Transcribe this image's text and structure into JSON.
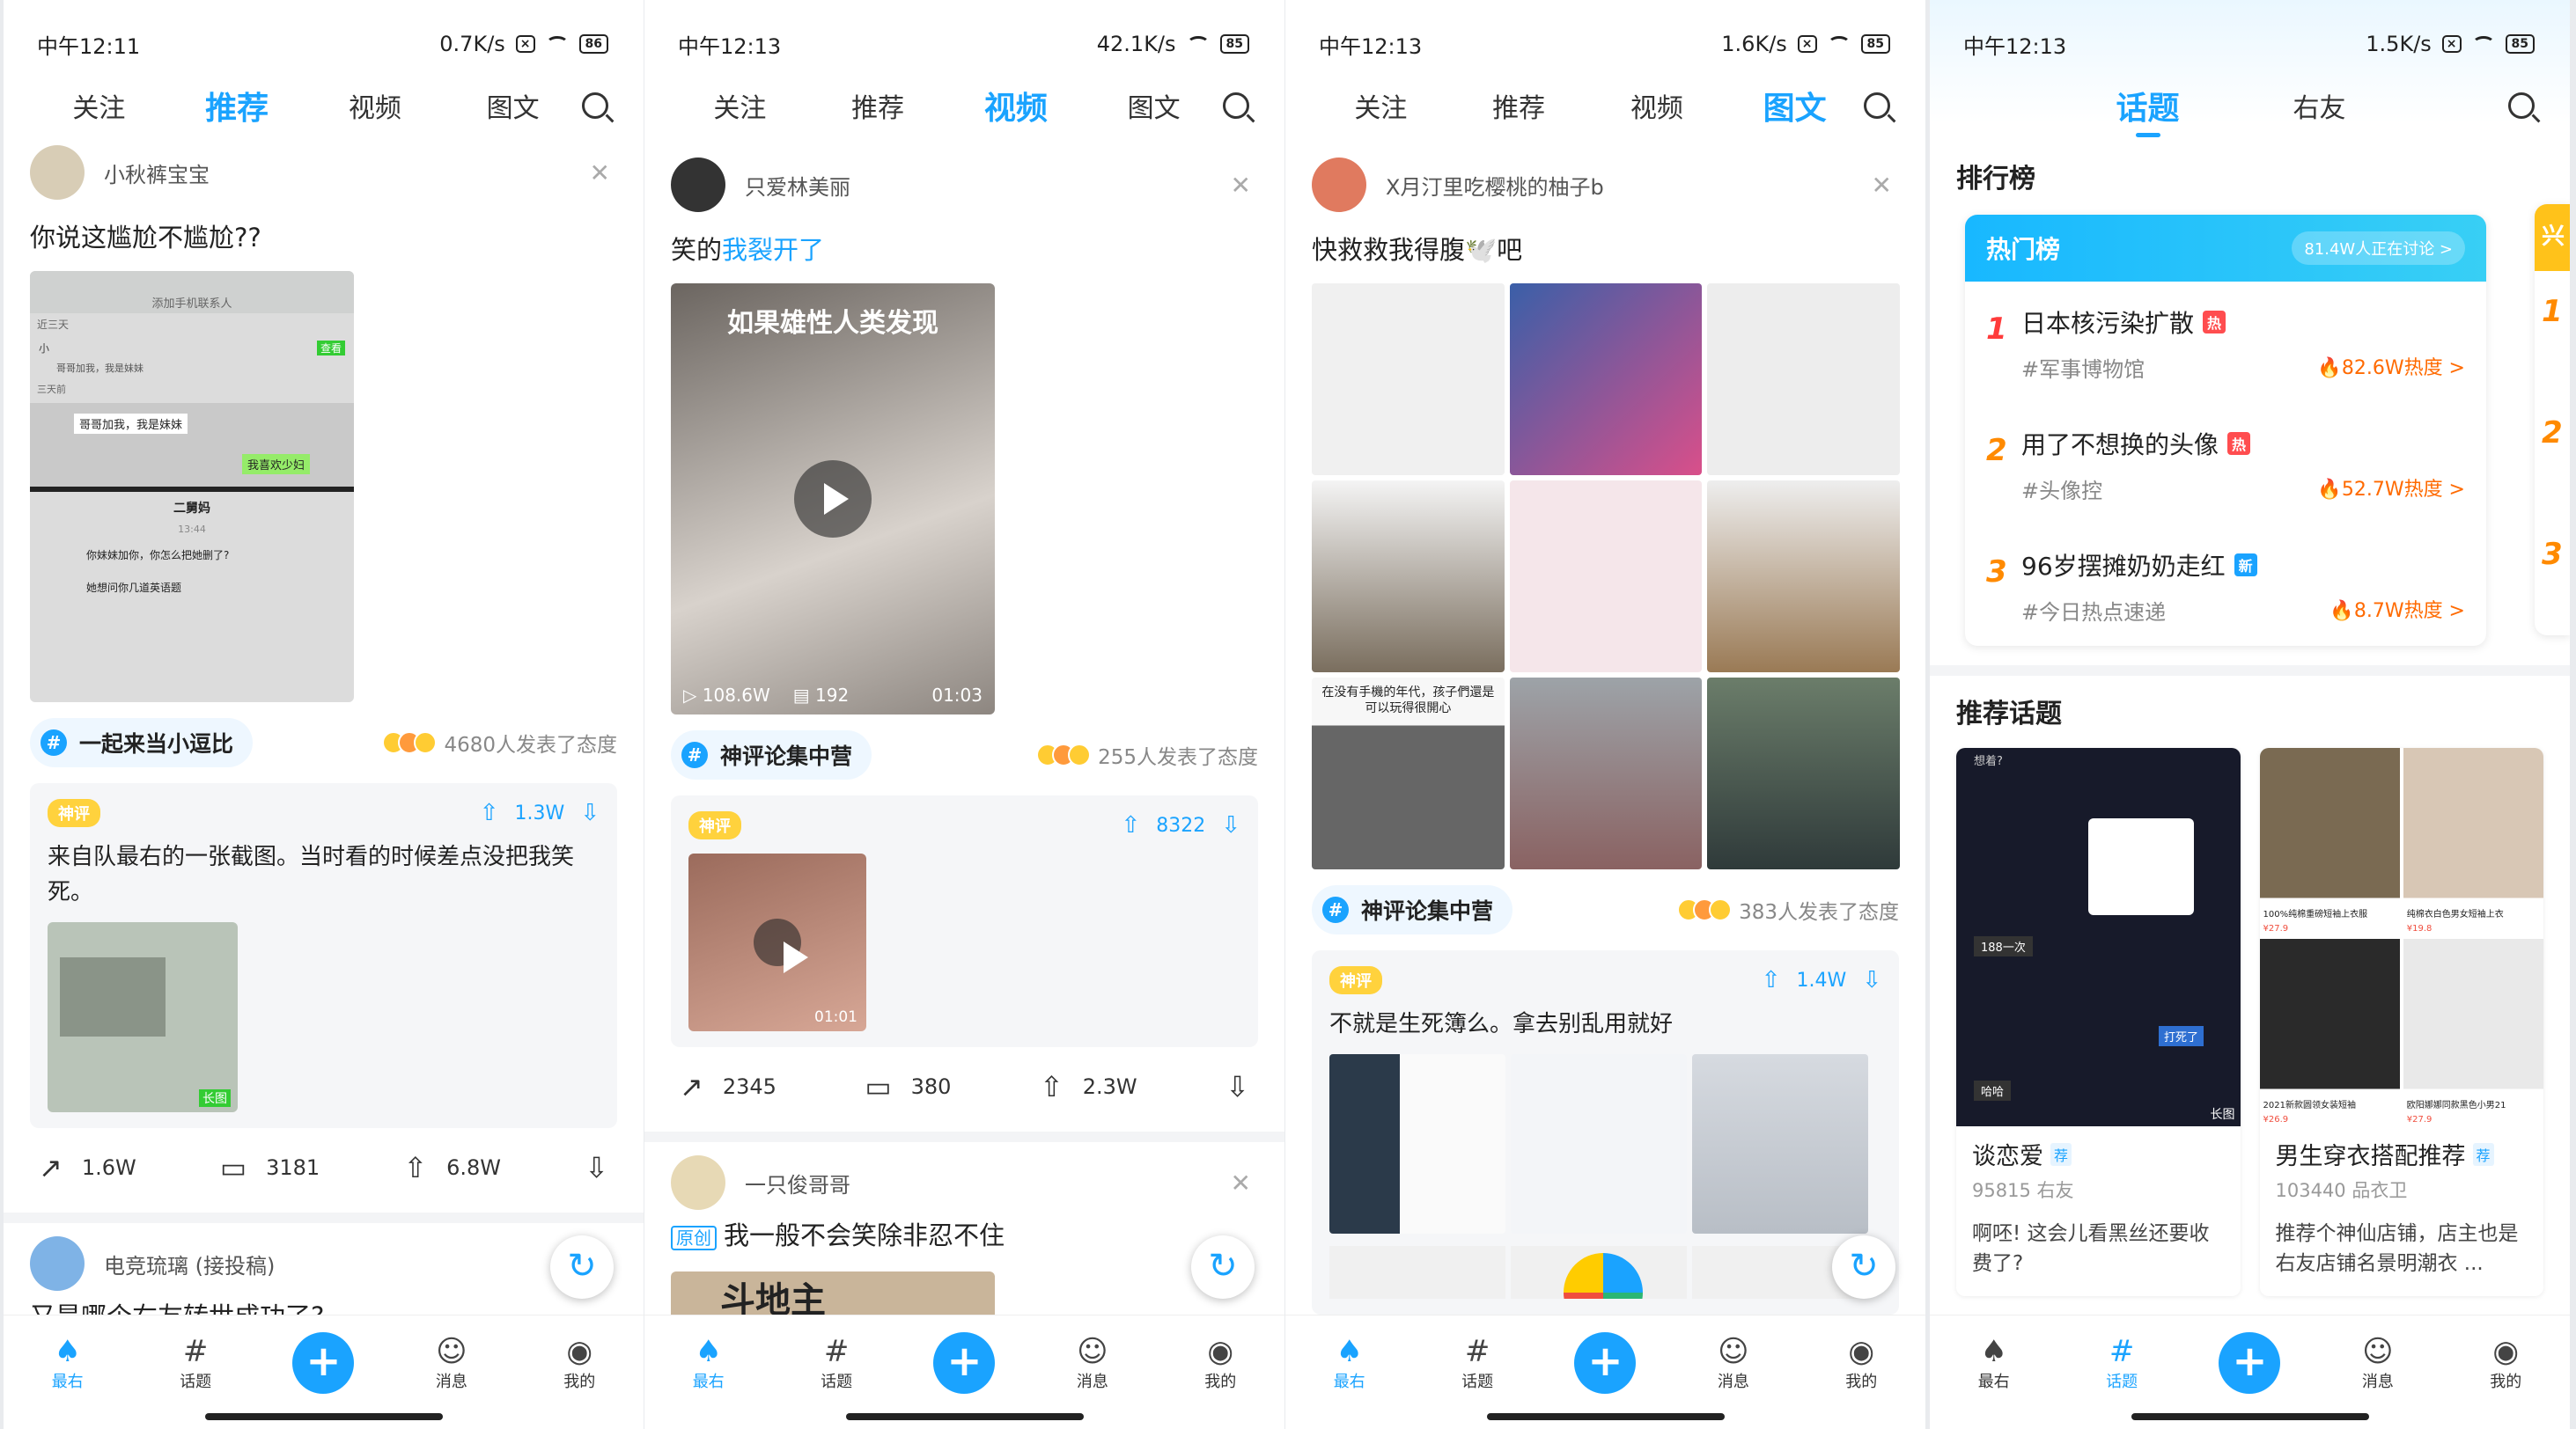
{
  "colors": {
    "accent": "#1aa3ff",
    "hot": "#ff6a00",
    "rank1": "#ff3b3b",
    "rank": "#ff8a00"
  },
  "screens": [
    {
      "status": {
        "time": "中午12:11",
        "speed": "0.7K/s",
        "battery": "86"
      },
      "tabs": [
        "关注",
        "推荐",
        "视频",
        "图文"
      ],
      "active_tab": 1,
      "post1": {
        "user": "小秋裤宝宝",
        "title": "你说这尴尬不尴尬??",
        "topic": "一起来当小逗比",
        "reactions": "4680人发表了态度",
        "hot": {
          "badge": "神评",
          "votes": "1.3W",
          "text": "来自队最右的一张截图。当时看的时候差点没把我笑死。",
          "long": "长图"
        },
        "img_texts": [
          "添加手机联系人",
          "近三天",
          "小",
          "哥哥加我，我是妹妹",
          "查看",
          "三天前",
          "哥哥加我，我是妹妹",
          "我喜欢少妇",
          "二舅妈",
          "13:44",
          "你妹妹加你，你怎么把她删了?",
          "她想问你几道英语题"
        ],
        "share": "1.6W",
        "comments": "3181",
        "likes": "6.8W"
      },
      "post2": {
        "user": "电竞琉璃 (接投稿)",
        "title": "又是哪个右友转世成功了?"
      }
    },
    {
      "status": {
        "time": "中午12:13",
        "speed": "42.1K/s",
        "battery": "85"
      },
      "tabs": [
        "关注",
        "推荐",
        "视频",
        "图文"
      ],
      "active_tab": 2,
      "post1": {
        "user": "只爱林美丽",
        "title_pre": "笑的",
        "title_hl": "我裂开了",
        "video_caption": "如果雄性人类发现",
        "views": "108.6W",
        "danmaku": "192",
        "duration": "01:03",
        "topic": "神评论集中营",
        "reactions": "255人发表了态度",
        "hot": {
          "badge": "神评",
          "votes": "8322",
          "duration": "01:01"
        },
        "share": "2345",
        "comments": "380",
        "likes": "2.3W"
      },
      "post2": {
        "user": "一只俊哥哥",
        "tag": "原创",
        "title": "我一般不会笑除非忍不住",
        "peek": "斗地主"
      }
    },
    {
      "status": {
        "time": "中午12:13",
        "speed": "1.6K/s",
        "battery": "85"
      },
      "tabs": [
        "关注",
        "推荐",
        "视频",
        "图文"
      ],
      "active_tab": 3,
      "post1": {
        "user": "X月汀里吃樱桃的柚子b",
        "title": "快救救我得腹🕊️吧",
        "topic": "神评论集中营",
        "reactions": "383人发表了态度",
        "grid_captions": [
          "在没有手機的年代，孩子們還是可以玩得很開心"
        ],
        "hot": {
          "badge": "神评",
          "votes": "1.4W",
          "text": "不就是生死簿么。拿去别乱用就好"
        }
      }
    },
    {
      "status": {
        "time": "中午12:13",
        "speed": "1.5K/s",
        "battery": "85"
      },
      "tabs": [
        "话题",
        "右友"
      ],
      "active_tab": 0,
      "rank": {
        "header": "排行榜",
        "card_title": "热门榜",
        "discussing": "81.4W人正在讨论 >",
        "side_title": "兴",
        "items": [
          {
            "num": "1",
            "title": "日本核污染扩散",
            "tag": "热",
            "tag_color": "#ff4d4f",
            "topic": "#军事博物馆",
            "heat": "82.6W热度 >"
          },
          {
            "num": "2",
            "title": "用了不想换的头像",
            "tag": "热",
            "tag_color": "#ff4d4f",
            "topic": "#头像控",
            "heat": "52.7W热度 >"
          },
          {
            "num": "3",
            "title": "96岁摆摊奶奶走红",
            "tag": "新",
            "tag_color": "#1aa3ff",
            "topic": "#今日热点速递",
            "heat": "8.7W热度 >"
          }
        ],
        "side_nums": [
          "1",
          "2",
          "3"
        ]
      },
      "recommend": {
        "header": "推荐话题",
        "cards": [
          {
            "name": "谈恋爱",
            "badge": "荐",
            "meta": "95815 右友",
            "desc": "啊呸! 这会儿看黑丝还要收费了?",
            "img_texts": [
              "想着?",
              "188一次",
              "打死了",
              "哈哈",
              "长图"
            ]
          },
          {
            "name": "男生穿衣搭配推荐",
            "badge": "荐",
            "meta": "103440 品衣卫",
            "desc": "推荐个神仙店铺，店主也是右友店铺名景明潮衣 ...",
            "img_texts": [
              "100%纯棉重磅短袖上衣服",
              "¥27.9",
              "纯棉衣白色男女短袖上衣",
              "¥19.8",
              "2021新款圆领女装短袖",
              "¥26.9",
              "欧阳娜娜同款黑色小男21",
              "¥27.9"
            ]
          }
        ]
      }
    }
  ],
  "bottom_nav": [
    {
      "label": "最右",
      "icon": "squid-icon"
    },
    {
      "label": "话题",
      "icon": "hash-icon"
    },
    {
      "label": "",
      "icon": "plus-icon"
    },
    {
      "label": "消息",
      "icon": "message-icon"
    },
    {
      "label": "我的",
      "icon": "profile-icon"
    }
  ]
}
